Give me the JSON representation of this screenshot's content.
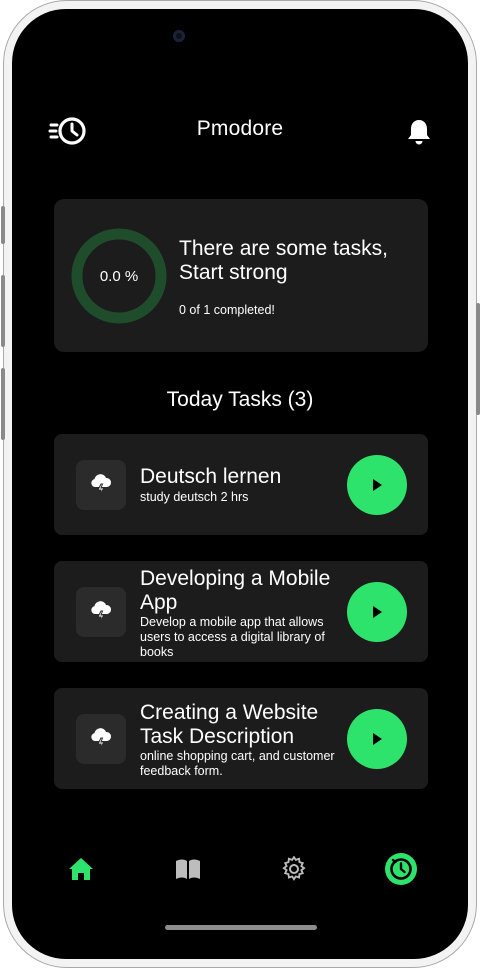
{
  "app": {
    "title": "Pmodore"
  },
  "summary": {
    "progress_text": "0.0 %",
    "progress_fraction": 0.0,
    "headline": "There are some tasks, Start strong",
    "subtext": "0 of 1 completed!"
  },
  "tasks_section": {
    "title": "Today Tasks (3)"
  },
  "tasks": [
    {
      "title": "Deutsch lernen",
      "description": "study deutsch 2 hrs",
      "icon": "weather-storm-icon"
    },
    {
      "title": "Developing a Mobile App",
      "description": "Develop a mobile app that allows users to access a digital library of books",
      "icon": "weather-storm-icon"
    },
    {
      "title": "Creating a Website Task Description",
      "description": "online shopping cart, and customer feedback form.",
      "icon": "weather-storm-icon"
    }
  ],
  "nav": {
    "items": [
      {
        "name": "home",
        "icon": "home-icon",
        "active": true
      },
      {
        "name": "library",
        "icon": "book-icon",
        "active": false
      },
      {
        "name": "settings",
        "icon": "gear-icon",
        "active": false
      },
      {
        "name": "timer",
        "icon": "timer-icon",
        "active": true
      }
    ]
  },
  "colors": {
    "accent": "#2ee36c",
    "background": "#000000",
    "card": "#1c1c1c",
    "ring_track": "#1f4d2c",
    "icon_muted": "#bdbdbd"
  }
}
